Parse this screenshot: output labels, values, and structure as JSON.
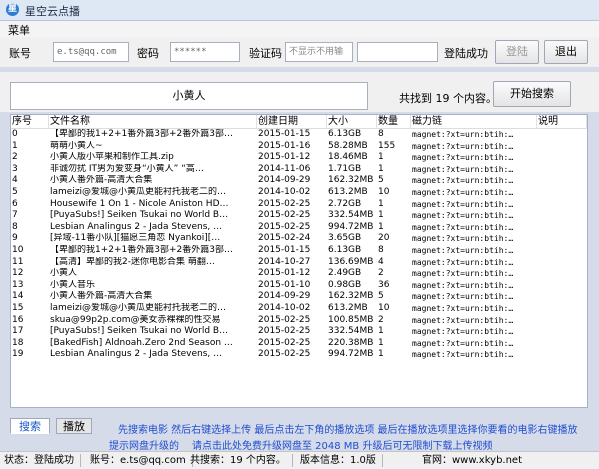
{
  "window": {
    "title": "星空云点播"
  },
  "menu": {
    "label": "菜单"
  },
  "login": {
    "account_label": "账号",
    "account_value": "e.ts@qq.com",
    "password_label": "密码",
    "password_value": "******",
    "captcha_label": "验证码",
    "captcha_value": "不显示不用输",
    "status": "登陆成功",
    "login_button": "登陆",
    "logout_button": "退出"
  },
  "search": {
    "query": "小黄人",
    "result_text": "共找到 19 个内容。",
    "button": "开始搜索"
  },
  "table": {
    "columns": [
      "序号",
      "文件名称",
      "创建日期",
      "大小",
      "数量",
      "磁力链",
      "说明"
    ],
    "rows": [
      [
        "0",
        "【卑鄙的我1+2+1番外篇3部+2番外篇3部…",
        "2015-01-15",
        "6.13GB",
        "8",
        "magnet:?xt=urn:btih:…",
        ""
      ],
      [
        "1",
        "萌萌小黄人~",
        "2015-01-16",
        "58.28MB",
        "155",
        "magnet:?xt=urn:btih:…",
        ""
      ],
      [
        "2",
        "小黄人版小苹果和制作工具.zip",
        "2015-01-12",
        "18.46MB",
        "1",
        "magnet:?xt=urn:btih:…",
        ""
      ],
      [
        "3",
        "非诚勿扰 IT男为爱变身“小黄人” “高…",
        "2014-11-06",
        "1.71GB",
        "1",
        "magnet:?xt=urn:btih:…",
        ""
      ],
      [
        "4",
        "小黄人番外篇-高清大合集",
        "2014-09-29",
        "162.32MB",
        "5",
        "magnet:?xt=urn:btih:…",
        ""
      ],
      [
        "5",
        "lameizi@爱城@小黄瓜更能衬托我老二的…",
        "2014-10-02",
        "613.2MB",
        "10",
        "magnet:?xt=urn:btih:…",
        ""
      ],
      [
        "6",
        "Housewife 1 On 1 - Nicole Aniston HD…",
        "2015-02-25",
        "2.72GB",
        "1",
        "magnet:?xt=urn:btih:…",
        ""
      ],
      [
        "7",
        "[PuyaSubs!] Seiken Tsukai no World B…",
        "2015-02-25",
        "332.54MB",
        "1",
        "magnet:?xt=urn:btih:…",
        ""
      ],
      [
        "8",
        "Lesbian Analingus 2 - Jada Stevens, …",
        "2015-02-25",
        "994.72MB",
        "1",
        "magnet:?xt=urn:btih:…",
        ""
      ],
      [
        "9",
        "[异域-11番小队][猫愿三角恋 Nyankoi][…",
        "2015-02-24",
        "3.65GB",
        "20",
        "magnet:?xt=urn:btih:…",
        ""
      ],
      [
        "10",
        "【卑鄙的我1+2+1番外篇3部+2番外篇3部…",
        "2015-01-15",
        "6.13GB",
        "8",
        "magnet:?xt=urn:btih:…",
        ""
      ],
      [
        "11",
        "【高清】卑鄙的我2-迷你电影合集 萌翻…",
        "2014-10-27",
        "136.69MB",
        "4",
        "magnet:?xt=urn:btih:…",
        ""
      ],
      [
        "12",
        "小黄人",
        "2015-01-12",
        "2.49GB",
        "2",
        "magnet:?xt=urn:btih:…",
        ""
      ],
      [
        "13",
        "小黄人音乐",
        "2015-01-10",
        "0.98GB",
        "36",
        "magnet:?xt=urn:btih:…",
        ""
      ],
      [
        "14",
        "小黄人番外篇-高清大合集",
        "2014-09-29",
        "162.32MB",
        "5",
        "magnet:?xt=urn:btih:…",
        ""
      ],
      [
        "15",
        "lameizi@爱城@小黄瓜更能衬托我老二的…",
        "2014-10-02",
        "613.2MB",
        "10",
        "magnet:?xt=urn:btih:…",
        ""
      ],
      [
        "16",
        "skua@99p2p.com@美女赤裸裸的性交易",
        "2015-02-25",
        "100.85MB",
        "2",
        "magnet:?xt=urn:btih:…",
        ""
      ],
      [
        "17",
        "[PuyaSubs!] Seiken Tsukai no World B…",
        "2015-02-25",
        "332.54MB",
        "1",
        "magnet:?xt=urn:btih:…",
        ""
      ],
      [
        "18",
        "[BakedFish] Aldnoah.Zero 2nd Season …",
        "2015-02-25",
        "220.38MB",
        "1",
        "magnet:?xt=urn:btih:…",
        ""
      ],
      [
        "19",
        "Lesbian Analingus 2 - Jada Stevens, …",
        "2015-02-25",
        "994.72MB",
        "1",
        "magnet:?xt=urn:btih:…",
        ""
      ]
    ]
  },
  "tabs": {
    "search": "搜索",
    "play": "播放"
  },
  "info": {
    "line1": "先搜索电影 然后右键选择上传 最后点击左下角的播放选项 最后在播放选项里选择你要看的电影右键播放",
    "upgrade_link": "提示网盘升级的",
    "line2": "请点击此处免费升级网盘至 2048 MB 升级后可无限制下载上传视频"
  },
  "status": {
    "state": "状态：登陆成功",
    "account": "账号：e.ts@qq.com",
    "shared": "共搜索：19 个内容。",
    "version": "版本信息：1.0版",
    "website": "官网：www.xkyb.net"
  },
  "colors": {
    "link": "#1f4fd1",
    "accent": "#2d7bd6"
  }
}
